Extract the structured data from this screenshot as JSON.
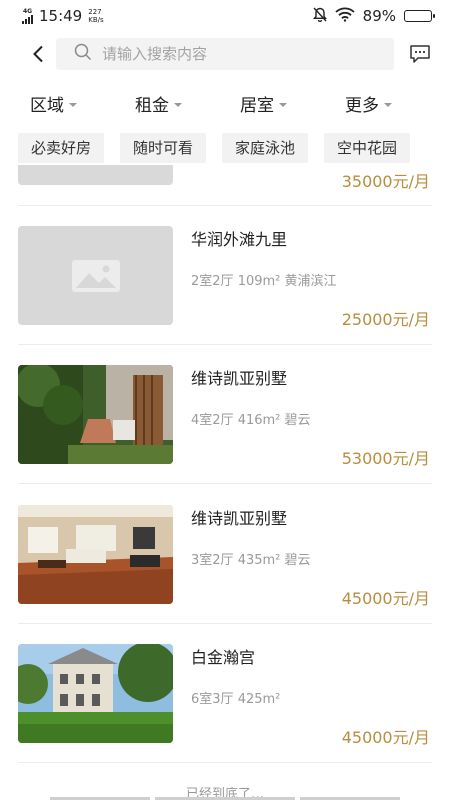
{
  "status_bar": {
    "network_type": "4G",
    "time": "15:49",
    "speed_value": "227",
    "speed_unit": "KB/s",
    "battery": "89%",
    "battery_level": 0.89
  },
  "search": {
    "placeholder": "请输入搜索内容"
  },
  "filters": [
    {
      "label": "区域"
    },
    {
      "label": "租金"
    },
    {
      "label": "居室"
    },
    {
      "label": "更多"
    }
  ],
  "tags": [
    "必卖好房",
    "随时可看",
    "家庭泳池",
    "空中花园"
  ],
  "partial_listing": {
    "price": "35000元/月"
  },
  "listings": [
    {
      "title": "华润外滩九里",
      "rooms": "2室2厅",
      "area": "109m²",
      "district": "黄浦滨江",
      "price": "25000元/月",
      "image": "placeholder-icon"
    },
    {
      "title": "维诗凯亚别墅",
      "rooms": "4室2厅",
      "area": "416m²",
      "district": "碧云",
      "price": "53000元/月",
      "image": "garden-stairs-photo"
    },
    {
      "title": "维诗凯亚别墅",
      "rooms": "3室2厅",
      "area": "435m²",
      "district": "碧云",
      "price": "45000元/月",
      "image": "living-room-photo"
    },
    {
      "title": "白金瀚宫",
      "rooms": "6室3厅",
      "area": "425m²",
      "district": "",
      "price": "45000元/月",
      "image": "villa-exterior-photo"
    }
  ],
  "footer": {
    "end_text": "已经到底了…"
  },
  "colors": {
    "price": "#b88d3d",
    "muted": "#9a9a9a",
    "tag_bg": "#f2f2f2",
    "search_bg": "#f3f3f3"
  }
}
